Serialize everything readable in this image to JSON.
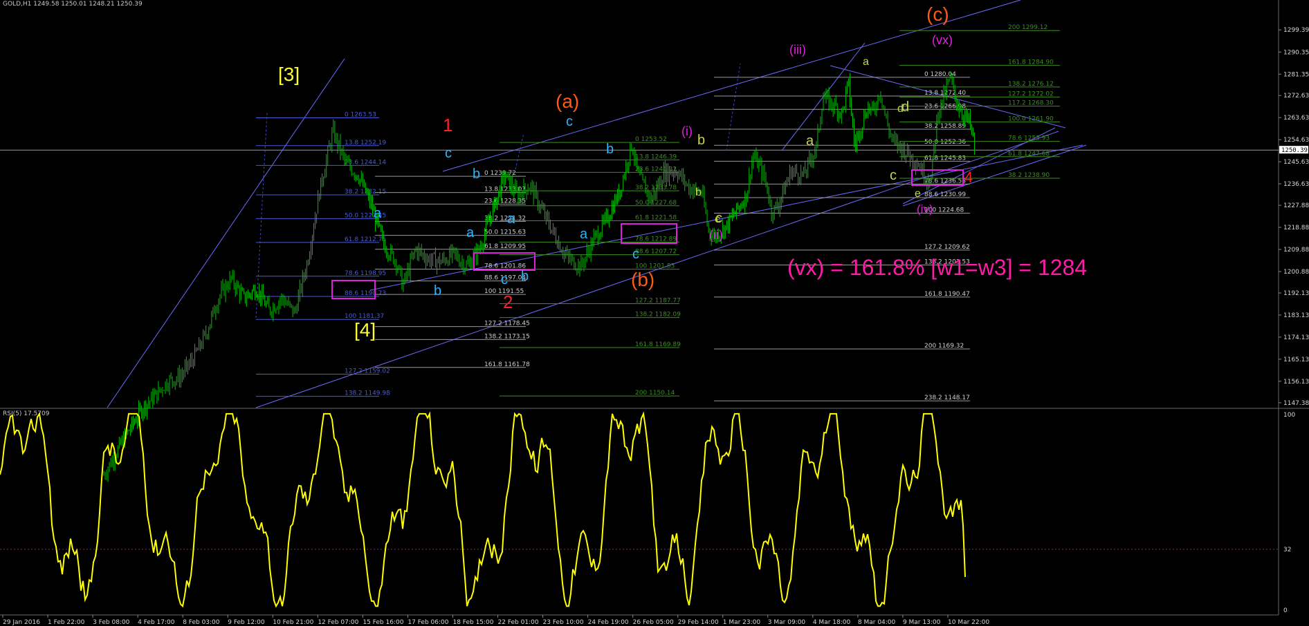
{
  "header": {
    "symbol_line": "GOLD,H1  1249.58 1250.01 1248.21 1250.39"
  },
  "rsi_panel": {
    "label": "RSI(5) 17.5709",
    "levels": [
      "100",
      "32",
      "0"
    ]
  },
  "colors": {
    "background": "#000000",
    "candles": "#00c000",
    "rsi": "#ffff00",
    "channel": "#6b6bff",
    "fib_blue": "#4a5bd6",
    "fib_green": "#3c8f1e",
    "box": "#e020e0",
    "current_price_line": "#9c9c9c"
  },
  "annotation": {
    "text": "(vx) = 161.8% [w1=w3] = 1284",
    "color": "#ff1aa8"
  },
  "chart_data": [
    {
      "type": "candlestick",
      "title": "GOLD,H1",
      "current_price": 1250.39,
      "ylim": [
        1146.5,
        1306.5
      ],
      "y_ticks": [
        1299.39,
        1290.35,
        1281.35,
        1272.63,
        1263.63,
        1254.63,
        1245.63,
        1236.63,
        1227.88,
        1218.88,
        1209.88,
        1200.88,
        1192.13,
        1183.13,
        1174.13,
        1165.13,
        1156.13,
        1147.38
      ],
      "x_ticks": [
        "29 Jan 2016",
        "1 Feb 22:00",
        "3 Feb 08:00",
        "4 Feb 17:00",
        "8 Feb 03:00",
        "9 Feb 12:00",
        "10 Feb 21:00",
        "12 Feb 07:00",
        "15 Feb 16:00",
        "17 Feb 06:00",
        "18 Feb 15:00",
        "22 Feb 01:00",
        "23 Feb 10:00",
        "24 Feb 19:00",
        "26 Feb 05:00",
        "29 Feb 14:00",
        "1 Mar 23:00",
        "3 Mar 09:00",
        "4 Mar 18:00",
        "8 Mar 04:00",
        "9 Mar 13:00",
        "10 Mar 22:00"
      ],
      "price_path": [
        [
          0,
          1118
        ],
        [
          3,
          1132
        ],
        [
          6,
          1145
        ],
        [
          8,
          1150
        ],
        [
          10,
          1156
        ],
        [
          12,
          1158
        ],
        [
          14,
          1165
        ],
        [
          16,
          1175
        ],
        [
          18,
          1190
        ],
        [
          20,
          1198
        ],
        [
          22,
          1190
        ],
        [
          24,
          1194
        ],
        [
          26,
          1185
        ],
        [
          28,
          1190
        ],
        [
          30,
          1184
        ],
        [
          32,
          1205
        ],
        [
          34,
          1235
        ],
        [
          36,
          1258
        ],
        [
          38,
          1245
        ],
        [
          40,
          1240
        ],
        [
          42,
          1228
        ],
        [
          44,
          1212
        ],
        [
          46,
          1205
        ],
        [
          47,
          1195
        ],
        [
          49,
          1210
        ],
        [
          51,
          1206
        ],
        [
          53,
          1205
        ],
        [
          55,
          1208
        ],
        [
          57,
          1203
        ],
        [
          59,
          1210
        ],
        [
          61,
          1225
        ],
        [
          63,
          1240
        ],
        [
          65,
          1232
        ],
        [
          67,
          1236
        ],
        [
          69,
          1225
        ],
        [
          71,
          1215
        ],
        [
          72,
          1210
        ],
        [
          73,
          1206
        ],
        [
          75,
          1203
        ],
        [
          77,
          1214
        ],
        [
          79,
          1222
        ],
        [
          81,
          1233
        ],
        [
          83,
          1253
        ],
        [
          84,
          1240
        ],
        [
          86,
          1230
        ],
        [
          88,
          1241
        ],
        [
          90,
          1242
        ],
        [
          92,
          1235
        ],
        [
          94,
          1233
        ],
        [
          95,
          1218
        ],
        [
          96,
          1215
        ],
        [
          98,
          1220
        ],
        [
          100,
          1228
        ],
        [
          101,
          1232
        ],
        [
          102,
          1248
        ],
        [
          103,
          1244
        ],
        [
          104,
          1238
        ],
        [
          105,
          1225
        ],
        [
          106,
          1228
        ],
        [
          108,
          1242
        ],
        [
          110,
          1240
        ],
        [
          112,
          1252
        ],
        [
          113,
          1272
        ],
        [
          115,
          1268
        ],
        [
          116,
          1265
        ],
        [
          117,
          1278
        ],
        [
          118,
          1252
        ],
        [
          120,
          1268
        ],
        [
          121,
          1266
        ],
        [
          122,
          1275
        ],
        [
          123,
          1262
        ],
        [
          124,
          1254
        ],
        [
          126,
          1250
        ],
        [
          128,
          1245
        ],
        [
          129,
          1240
        ],
        [
          130,
          1238
        ],
        [
          131,
          1265
        ],
        [
          132,
          1272
        ],
        [
          133,
          1280
        ],
        [
          134,
          1270
        ],
        [
          135,
          1265
        ],
        [
          136,
          1262
        ],
        [
          137,
          1250
        ]
      ],
      "price_path_note_units": "x is hourly bar index within the visible window, y is price",
      "wave_labels": [
        {
          "text": "[3]",
          "color": "#ffff33"
        },
        {
          "text": "[4]",
          "color": "#ffff33"
        },
        {
          "text": "1",
          "color": "#ff2020"
        },
        {
          "text": "2",
          "color": "#ff2020"
        },
        {
          "text": "4",
          "color": "#ff2020"
        },
        {
          "text": "(a)",
          "color": "#ff5a14"
        },
        {
          "text": "(b)",
          "color": "#ff5a14"
        },
        {
          "text": "(c)",
          "color": "#ff5a14"
        },
        {
          "text": "(i)",
          "color": "#e020e0"
        },
        {
          "text": "(ii)",
          "color": "#e020e0"
        },
        {
          "text": "(iii)",
          "color": "#e020e0"
        },
        {
          "text": "(iv)",
          "color": "#e020e0"
        },
        {
          "text": "(vx)",
          "color": "#e020e0"
        },
        {
          "text": "a",
          "color": "#2ab4ff"
        },
        {
          "text": "b",
          "color": "#2ab4ff"
        },
        {
          "text": "c",
          "color": "#2ab4ff"
        },
        {
          "text": "a",
          "color": "#c8d44a"
        },
        {
          "text": "b",
          "color": "#c8d44a"
        },
        {
          "text": "c",
          "color": "#c8d44a"
        },
        {
          "text": "d",
          "color": "#c8d44a"
        },
        {
          "text": "e",
          "color": "#c8d44a"
        }
      ],
      "fib_levels": [
        {
          "label": "0 1263.53",
          "color": "blue"
        },
        {
          "label": "13.8 1252.19",
          "color": "blue"
        },
        {
          "label": "23.6 1244.14",
          "color": "blue"
        },
        {
          "label": "38.2 1232.15",
          "color": "blue"
        },
        {
          "label": "50.0 1222.45",
          "color": "blue"
        },
        {
          "label": "61.8 1212.75",
          "color": "blue"
        },
        {
          "label": "78.6 1198.95",
          "color": "blue"
        },
        {
          "label": "88.6 1190.73",
          "color": "blue"
        },
        {
          "label": "100 1181.37",
          "color": "blue"
        },
        {
          "label": "127.2 1159.02",
          "color": "blue"
        },
        {
          "label": "138.2 1149.98",
          "color": "blue"
        },
        {
          "label": "0 1239.72",
          "color": "gray"
        },
        {
          "label": "13.8 1233.07",
          "color": "gray"
        },
        {
          "label": "23.6 1228.35",
          "color": "gray"
        },
        {
          "label": "38.2 1221.32",
          "color": "gray"
        },
        {
          "label": "50.0 1215.63",
          "color": "gray"
        },
        {
          "label": "61.8 1209.95",
          "color": "gray"
        },
        {
          "label": "78.6 1201.86",
          "color": "gray"
        },
        {
          "label": "88.6 1197.04",
          "color": "gray"
        },
        {
          "label": "100 1191.55",
          "color": "gray"
        },
        {
          "label": "127.2 1178.45",
          "color": "gray"
        },
        {
          "label": "138.2 1173.15",
          "color": "gray"
        },
        {
          "label": "161.8 1161.78",
          "color": "gray"
        },
        {
          "label": "0 1253.52",
          "color": "green"
        },
        {
          "label": "13.8 1246.39",
          "color": "green"
        },
        {
          "label": "23.6 1241.32",
          "color": "green"
        },
        {
          "label": "38.2 1233.78",
          "color": "green"
        },
        {
          "label": "50.0 1227.68",
          "color": "green"
        },
        {
          "label": "61.8 1221.58",
          "color": "green"
        },
        {
          "label": "78.6 1212.89",
          "color": "green"
        },
        {
          "label": "88.6 1207.72",
          "color": "green"
        },
        {
          "label": "100 1201.83",
          "color": "green"
        },
        {
          "label": "127.2 1187.77",
          "color": "green"
        },
        {
          "label": "138.2 1182.09",
          "color": "green"
        },
        {
          "label": "161.8 1169.89",
          "color": "green"
        },
        {
          "label": "200 1150.14",
          "color": "green"
        },
        {
          "label": "0 1280.04",
          "color": "gray"
        },
        {
          "label": "13.8 1272.40",
          "color": "gray"
        },
        {
          "label": "23.6 1266.98",
          "color": "gray"
        },
        {
          "label": "38.2 1258.89",
          "color": "gray"
        },
        {
          "label": "50.0 1252.36",
          "color": "gray"
        },
        {
          "label": "61.8 1245.83",
          "color": "gray"
        },
        {
          "label": "78.6 1236.53",
          "color": "gray"
        },
        {
          "label": "88.6 1230.99",
          "color": "gray"
        },
        {
          "label": "100 1224.68",
          "color": "gray"
        },
        {
          "label": "127.2 1209.62",
          "color": "gray"
        },
        {
          "label": "138.2 1203.53",
          "color": "gray"
        },
        {
          "label": "161.8 1190.47",
          "color": "gray"
        },
        {
          "label": "200 1169.32",
          "color": "gray"
        },
        {
          "label": "238.2 1148.17",
          "color": "gray"
        },
        {
          "label": "200 1299.12",
          "color": "green"
        },
        {
          "label": "161.8 1284.90",
          "color": "green"
        },
        {
          "label": "138.2 1276.12",
          "color": "green"
        },
        {
          "label": "127.2 1272.02",
          "color": "green"
        },
        {
          "label": "117.2 1268.30",
          "color": "green"
        },
        {
          "label": "100.0 1261.90",
          "color": "green"
        },
        {
          "label": "78.6 1253.93",
          "color": "green"
        },
        {
          "label": "61.8 1247.68",
          "color": "green"
        },
        {
          "label": "38.2 1238.90",
          "color": "green"
        }
      ]
    },
    {
      "type": "line",
      "title": "RSI(5) 17.5709",
      "ylim": [
        0,
        100
      ],
      "y_ticks": [
        100,
        32,
        0
      ],
      "last_value": 17.5709
    }
  ]
}
